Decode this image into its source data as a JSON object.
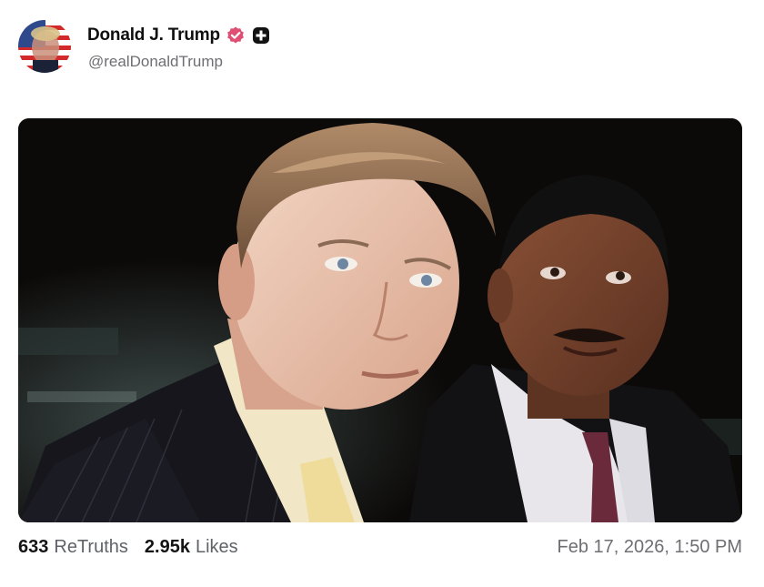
{
  "author": {
    "display_name": "Donald J. Trump",
    "handle": "@realDonaldTrump",
    "avatar_icon": "flag-portrait-avatar",
    "verified_icon": "verified-badge-icon",
    "verified_color": "#e04f73",
    "extra_icon": "plus-square-icon"
  },
  "media": {
    "type": "photo",
    "description_icon": "two-men-in-suits-photo"
  },
  "stats": {
    "retruths_count": "633",
    "retruths_label": "ReTruths",
    "likes_count": "2.95k",
    "likes_label": "Likes"
  },
  "timestamp": "Feb 17, 2026, 1:50 PM"
}
